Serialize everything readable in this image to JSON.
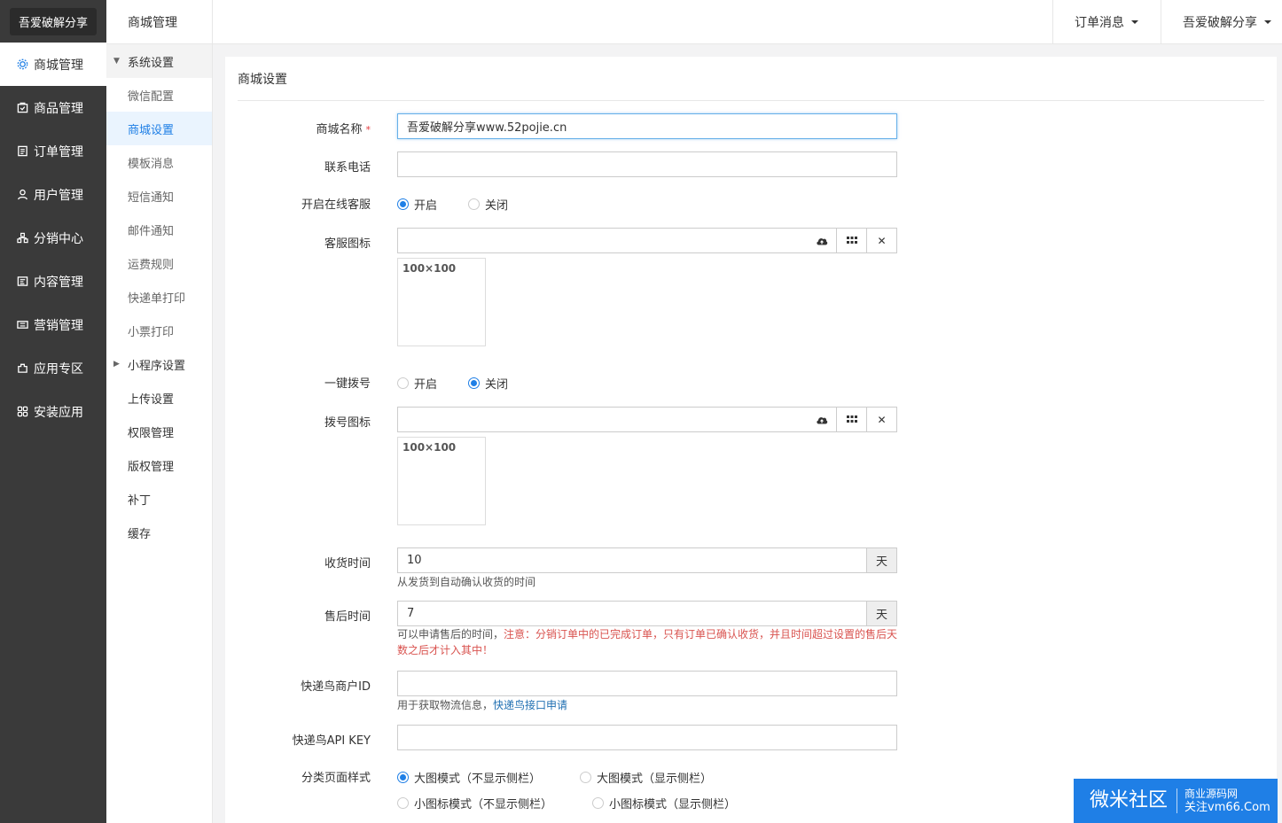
{
  "brand": "吾爱破解分享",
  "sidebar": {
    "items": [
      {
        "label": "商城管理",
        "icon": "gear-icon"
      },
      {
        "label": "商品管理",
        "icon": "product-icon"
      },
      {
        "label": "订单管理",
        "icon": "order-icon"
      },
      {
        "label": "用户管理",
        "icon": "user-icon"
      },
      {
        "label": "分销中心",
        "icon": "distribution-icon"
      },
      {
        "label": "内容管理",
        "icon": "content-icon"
      },
      {
        "label": "营销管理",
        "icon": "marketing-icon"
      },
      {
        "label": "应用专区",
        "icon": "app-icon"
      },
      {
        "label": "安装应用",
        "icon": "install-icon"
      }
    ]
  },
  "subnav": {
    "title": "商城管理",
    "group1": "系统设置",
    "items1": [
      "微信配置",
      "商城设置",
      "模板消息",
      "短信通知",
      "邮件通知",
      "运费规则",
      "快递单打印",
      "小票打印"
    ],
    "group2": "小程序设置",
    "items2": [
      "上传设置",
      "权限管理",
      "版权管理",
      "补丁",
      "缓存"
    ]
  },
  "topbar": {
    "orders": "订单消息",
    "user": "吾爱破解分享"
  },
  "panel": {
    "title": "商城设置"
  },
  "form": {
    "store_name_label": "商城名称",
    "store_name_required": "*",
    "store_name_value": "吾爱破解分享www.52pojie.cn",
    "phone_label": "联系电话",
    "phone_value": "",
    "cs_label": "开启在线客服",
    "cs_on": "开启",
    "cs_off": "关闭",
    "cs_icon_label": "客服图标",
    "cs_icon_placeholder": "100×100",
    "dial_label": "一键拨号",
    "dial_on": "开启",
    "dial_off": "关闭",
    "dial_icon_label": "拨号图标",
    "dial_icon_placeholder": "100×100",
    "receive_label": "收货时间",
    "receive_value": "10",
    "receive_unit": "天",
    "receive_help": "从发货到自动确认收货的时间",
    "aftersale_label": "售后时间",
    "aftersale_value": "7",
    "aftersale_unit": "天",
    "aftersale_help_a": "可以申请售后的时间，",
    "aftersale_help_warn": "注意：分销订单中的已完成订单，只有订单已确认收货，并且时间超过设置的售后天数之后才计入其中！",
    "kdn_id_label": "快递鸟商户ID",
    "kdn_id_help_a": "用于获取物流信息，",
    "kdn_id_help_link": "快递鸟接口申请",
    "kdn_key_label": "快递鸟API KEY",
    "cat_label": "分类页面样式",
    "cat_opt1": "大图模式（不显示侧栏）",
    "cat_opt2": "大图模式（显示侧栏）",
    "cat_opt3": "小图标模式（不显示侧栏）",
    "cat_opt4": "小图标模式（显示侧栏）"
  },
  "watermark": {
    "left": "微米社区",
    "right_top": "商业源码网",
    "right_bottom": "关注vm66.Com"
  },
  "colors": {
    "accent": "#1f7fe6",
    "sidebar_bg": "#3a3a3a",
    "warn": "#d9534f"
  }
}
